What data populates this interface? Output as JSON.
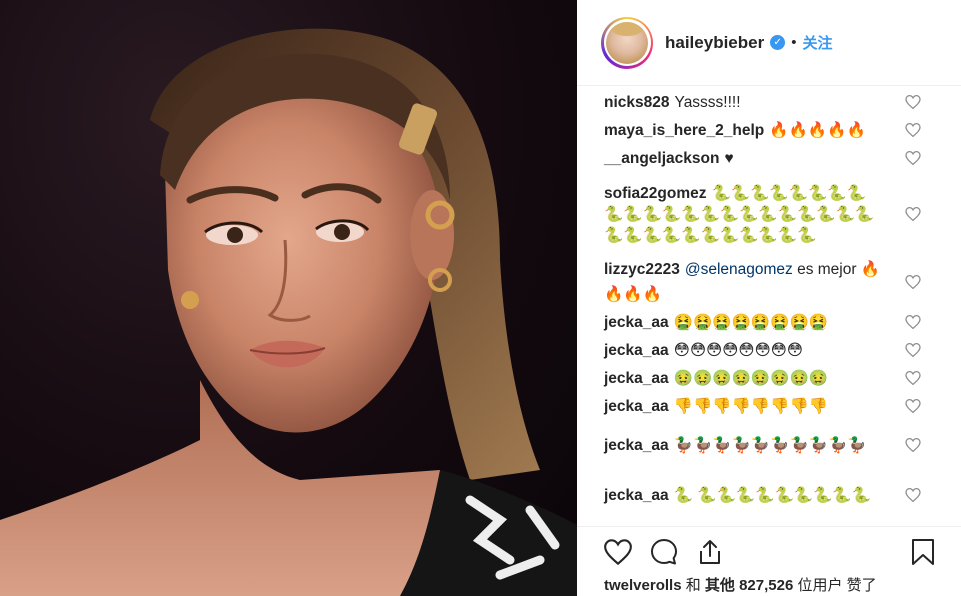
{
  "post": {
    "username": "haileybieber",
    "separator": "•",
    "follow_label": "关注"
  },
  "comments": [
    {
      "user": "nicks828",
      "text": "Yassss!!!!",
      "mention": ""
    },
    {
      "user": "maya_is_here_2_help",
      "text": "🔥🔥🔥🔥🔥",
      "mention": ""
    },
    {
      "user": "__angeljackson",
      "text": "♥",
      "mention": ""
    },
    {
      "user": "sofia22gomez",
      "text": "🐍🐍🐍🐍🐍🐍🐍🐍🐍🐍🐍🐍🐍🐍🐍🐍🐍🐍🐍🐍🐍🐍🐍🐍🐍🐍🐍🐍🐍🐍🐍🐍🐍",
      "mention": ""
    },
    {
      "user": "lizzyc2223",
      "mention": "@selenagomez",
      "text": " es mejor 🔥🔥🔥🔥"
    },
    {
      "user": "jecka_aa",
      "text": "🤮🤮🤮🤮🤮🤮🤮🤮",
      "mention": ""
    },
    {
      "user": "jecka_aa",
      "text": "😳😳😳😳😳😳😳😳",
      "mention": ""
    },
    {
      "user": "jecka_aa",
      "text": "🤢🤢🤢🤢🤢🤢🤢🤢",
      "mention": ""
    },
    {
      "user": "jecka_aa",
      "text": "👎👎👎👎👎👎👎👎",
      "mention": ""
    },
    {
      "user": "jecka_aa",
      "text": "🦆🦆🦆🦆🦆🦆🦆🦆🦆🦆",
      "mention": ""
    },
    {
      "user": "jecka_aa",
      "text": "🐍 🐍🐍🐍🐍🐍🐍🐍🐍🐍",
      "mention": ""
    }
  ],
  "likes": {
    "user": "twelverolls",
    "and": "和",
    "others": "其他",
    "count": "827,526",
    "suffix": "位用户 赞了"
  },
  "icons": {
    "heart": "heart-icon",
    "comment": "comment-icon",
    "share": "share-icon",
    "save": "bookmark-icon",
    "verified": "verified-badge-icon"
  },
  "colors": {
    "link": "#3897f0",
    "mention": "#003569",
    "text": "#262626"
  }
}
